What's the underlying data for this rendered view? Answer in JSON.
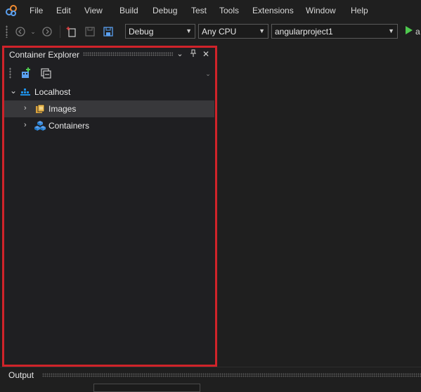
{
  "menu": {
    "items": [
      "File",
      "Edit",
      "View",
      "Build",
      "Debug",
      "Test",
      "Tools",
      "Extensions",
      "Window",
      "Help"
    ]
  },
  "toolbar": {
    "configuration": "Debug",
    "platform": "Any CPU",
    "startup_project": "angularproject1",
    "run_label": "a"
  },
  "panel": {
    "title": "Container Explorer",
    "dropdown_glyph": "⌄",
    "pin_glyph": "⊥",
    "close_glyph": "✕"
  },
  "tree": {
    "root": {
      "label": "Localhost",
      "expanded": true
    },
    "children": [
      {
        "label": "Images",
        "selected": true,
        "expanded": false
      },
      {
        "label": "Containers",
        "selected": false,
        "expanded": false
      }
    ]
  },
  "output": {
    "title": "Output"
  },
  "colors": {
    "highlight_border": "#d0232a",
    "selected_row": "#38383b",
    "run_green": "#4ec94e",
    "docker_blue": "#1e90e6"
  }
}
